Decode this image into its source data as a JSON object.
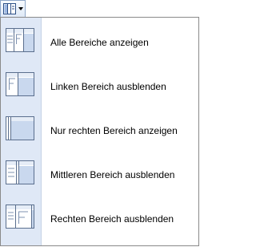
{
  "toolbar": {
    "button_icon": "view-panes-icon",
    "dropdown_icon": "dropdown-arrow-icon"
  },
  "menu": {
    "items": [
      {
        "label": "Alle Bereiche anzeigen",
        "icon": "all-panes-icon"
      },
      {
        "label": "Linken Bereich ausblenden",
        "icon": "hide-left-pane-icon"
      },
      {
        "label": "Nur rechten Bereich anzeigen",
        "icon": "right-pane-only-icon"
      },
      {
        "label": "Mittleren Bereich ausblenden",
        "icon": "hide-middle-pane-icon"
      },
      {
        "label": "Rechten Bereich ausblenden",
        "icon": "hide-right-pane-icon"
      }
    ]
  },
  "colors": {
    "gutter": "#dfe8f6",
    "icon_stroke": "#5b6f8e",
    "pane_fill": "#c9d8ee"
  }
}
